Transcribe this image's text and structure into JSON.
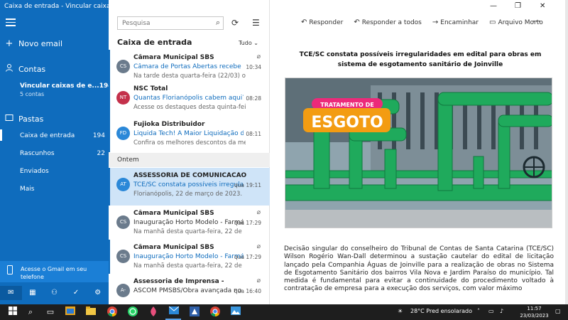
{
  "window": {
    "title": "Caixa de entrada - Vincular caixas de entrada"
  },
  "sidebar": {
    "new_email": "Novo email",
    "accounts_label": "Contas",
    "linked_account": {
      "label": "Vincular caixas de e...",
      "count": "194",
      "sub": "5 contas"
    },
    "folders_label": "Pastas",
    "folders": [
      {
        "label": "Caixa de entrada",
        "count": "194"
      },
      {
        "label": "Rascunhos",
        "count": "22"
      },
      {
        "label": "Enviados",
        "count": ""
      },
      {
        "label": "Mais",
        "count": ""
      }
    ],
    "gmail_promo": "Acesse o Gmail em seu telefone"
  },
  "list": {
    "search_placeholder": "Pesquisa",
    "heading": "Caixa de entrada",
    "filter": "Tudo",
    "group_label": "Ontem",
    "messages": [
      {
        "from": "Câmara Municipal SBS",
        "subject": "Câmara de Portas Abertas recebe alunos",
        "preview": "Na tarde desta quarta-feira (22/03) o Pro",
        "time": "10:34",
        "avatar": "CS",
        "avatar_color": "#6b7b8c",
        "unread": true,
        "attachment": true,
        "selected": false
      },
      {
        "from": "NSC Total",
        "subject": "Quantas Florianópolis cabem aqui? As h",
        "preview": "Acesse os destaques desta quinta-feira c",
        "time": "08:28",
        "avatar": "NT",
        "avatar_color": "#c4314b",
        "unread": true,
        "attachment": false,
        "selected": false
      },
      {
        "from": "Fujioka Distribuidor",
        "subject": "Liquida Tech! A Maior Liquidação de Te",
        "preview": "Confira os melhores descontos da melh",
        "time": "08:11",
        "avatar": "FD",
        "avatar_color": "#2b88d8",
        "unread": true,
        "attachment": false,
        "selected": false
      },
      {
        "from": "ASSESSORIA DE COMUNICACAO SC",
        "subject": "TCE/SC constata possíveis irregulari",
        "preview": "Florianópolis, 22 de março de 2023.",
        "time": "qua 19:11",
        "avatar": "AT",
        "avatar_color": "#2b88d8",
        "unread": true,
        "attachment": false,
        "selected": true
      },
      {
        "from": "Câmara Municipal SBS",
        "subject": "Inauguração Horto Modelo - Farmác",
        "preview": "Na manhã desta quarta-feira, 22 de",
        "time": "qua 17:29",
        "avatar": "CS",
        "avatar_color": "#6b7b8c",
        "unread": false,
        "attachment": true,
        "selected": false
      },
      {
        "from": "Câmara Municipal SBS",
        "subject": "Inauguração Horto Modelo - Farmá",
        "preview": "Na manhã desta quarta-feira, 22 de",
        "time": "qua 17:29",
        "avatar": "CS",
        "avatar_color": "#6b7b8c",
        "unread": true,
        "attachment": true,
        "selected": false
      },
      {
        "from": "Assessoria de Imprensa -",
        "subject": "ASCOM PMSBS/Obra avançada no p",
        "preview": "",
        "time": "qua 16:40",
        "avatar": "A-",
        "avatar_color": "#6b7b8c",
        "unread": false,
        "attachment": true,
        "selected": false
      }
    ]
  },
  "reader": {
    "actions": [
      {
        "icon": "reply-icon",
        "glyph": "↶",
        "label": "Responder"
      },
      {
        "icon": "reply-all-icon",
        "glyph": "↶",
        "label": "Responder a todos"
      },
      {
        "icon": "forward-icon",
        "glyph": "→",
        "label": "Encaminhar"
      },
      {
        "icon": "archive-icon",
        "glyph": "▭",
        "label": "Arquivo Morto"
      }
    ],
    "more": "···",
    "title": "TCE/SC constata possíveis irregularidades em edital para obras em sistema de esgotamento sanitário de Joinville",
    "image_tag_small": "TRATAMENTO DE",
    "image_tag_big": "ESGOTO",
    "body": "Decisão singular do conselheiro do Tribunal de Contas de Santa Catarina (TCE/SC) Wilson Rogério Wan-Dall determinou a sustação cautelar do edital de licitação lançado pela Companhia Águas de Joinville para a realização de obras no Sistema de Esgotamento Sanitário dos bairros Vila Nova e Jardim Paraíso do município. Tal medida é fundamental para evitar a continuidade do procedimento voltado à contratação de empresa para a execução dos serviços, com valor máximo"
  },
  "taskbar": {
    "weather": "28°C  Pred ensolarado",
    "time": "11:57",
    "date": "23/03/2023"
  },
  "colors": {
    "accent": "#0f6cbd",
    "selected_row": "#cfe4f8",
    "pipe_green": "#1faa5c",
    "tag_orange": "#f39c12"
  }
}
